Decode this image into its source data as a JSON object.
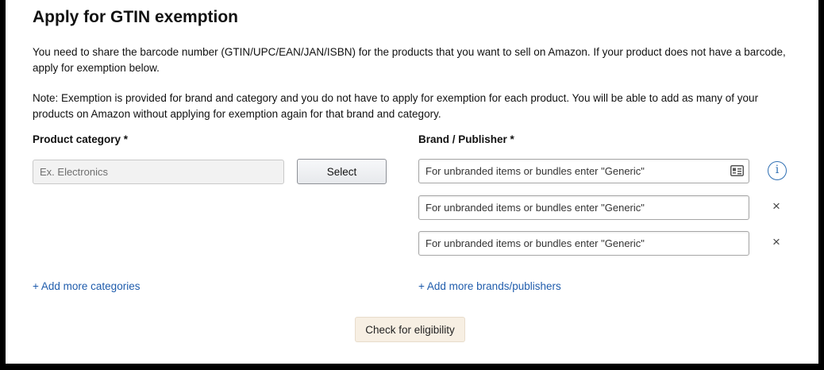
{
  "page": {
    "title": "Apply for GTIN exemption",
    "intro": "You need to share the barcode number (GTIN/UPC/EAN/JAN/ISBN) for the products that you want to sell on Amazon. If your product does not have a barcode, apply for exemption below.",
    "note": "Note: Exemption is provided for brand and category and you do not have to apply for exemption for each product. You will be able to add as many of your products on Amazon without applying for exemption again for that brand and category."
  },
  "category": {
    "label": "Product category *",
    "placeholder": "Ex. Electronics",
    "select_label": "Select",
    "add_more": "+ Add more categories"
  },
  "brand": {
    "label": "Brand / Publisher *",
    "inputs": [
      {
        "placeholder": "For unbranded items or bundles enter \"Generic\"",
        "value": ""
      },
      {
        "placeholder": "For unbranded items or bundles enter \"Generic\"",
        "value": ""
      },
      {
        "placeholder": "For unbranded items or bundles enter \"Generic\"",
        "value": ""
      }
    ],
    "add_more": "+ Add more brands/publishers",
    "info_glyph": "i",
    "remove_glyph": "×"
  },
  "actions": {
    "check_eligibility": "Check for eligibility"
  },
  "icons": {
    "contact_card": "contact-card-icon",
    "info": "info-icon",
    "remove": "close-icon"
  },
  "colors": {
    "link": "#1f5cac",
    "info_accent": "#2f6fb3",
    "check_button_bg": "#f7efe3"
  }
}
